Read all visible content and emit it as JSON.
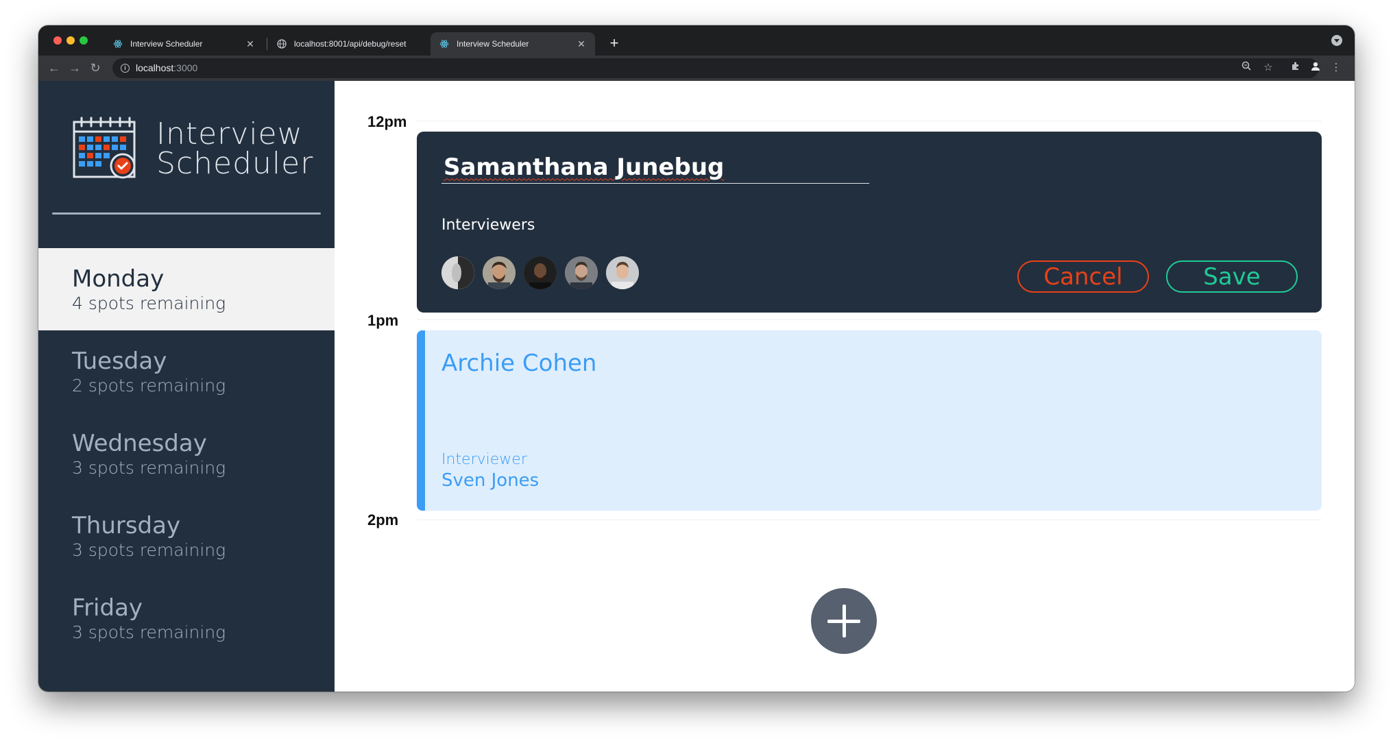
{
  "browser": {
    "tabs": [
      {
        "title": "Interview Scheduler",
        "active": false,
        "favicon": "react-icon"
      },
      {
        "title": "localhost:8001/api/debug/reset",
        "active": false,
        "favicon": "globe-icon"
      },
      {
        "title": "Interview Scheduler",
        "active": true,
        "favicon": "react-icon"
      }
    ],
    "url_host": "localhost",
    "url_port": ":3000"
  },
  "sidebar": {
    "brand_line1": "Interview",
    "brand_line2": "Scheduler",
    "days": [
      {
        "name": "Monday",
        "spots": "4 spots remaining",
        "selected": true
      },
      {
        "name": "Tuesday",
        "spots": "2 spots remaining",
        "selected": false
      },
      {
        "name": "Wednesday",
        "spots": "3 spots remaining",
        "selected": false
      },
      {
        "name": "Thursday",
        "spots": "3 spots remaining",
        "selected": false
      },
      {
        "name": "Friday",
        "spots": "3 spots remaining",
        "selected": false
      }
    ]
  },
  "schedule": {
    "times": [
      "12pm",
      "1pm",
      "2pm"
    ],
    "form": {
      "student_value": "Samanthana Junebug",
      "interviewers_label": "Interviewers",
      "cancel_label": "Cancel",
      "save_label": "Save"
    },
    "appointment": {
      "student": "Archie Cohen",
      "interviewer_label": "Interviewer",
      "interviewer_name": "Sven Jones"
    }
  },
  "colors": {
    "sidebar_bg": "#222f3e",
    "cancel": "#e84118",
    "save": "#20c997",
    "appointment_accent": "#3b9df4",
    "add_button": "#57606f"
  }
}
